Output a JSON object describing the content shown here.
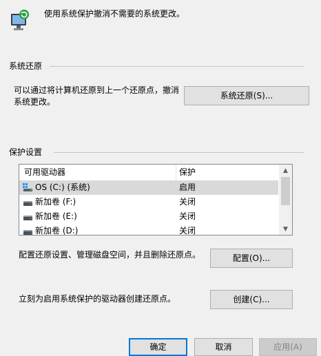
{
  "header": {
    "description": "使用系统保护撤消不需要的系统更改。"
  },
  "restore": {
    "group_label": "系统还原",
    "description_line1": "可以通过将计算机还原到上一个还原点，撤消",
    "description_line2": "系统更改。",
    "button_label": "系统还原(S)..."
  },
  "protection": {
    "group_label": "保护设置",
    "columns": [
      "可用驱动器",
      "保护"
    ],
    "drives": [
      {
        "name": "OS (C:) (系统)",
        "status": "启用",
        "icon": "system-drive-icon"
      },
      {
        "name": "新加卷 (F:)",
        "status": "关闭",
        "icon": "drive-icon"
      },
      {
        "name": "新加卷 (E:)",
        "status": "关闭",
        "icon": "drive-icon"
      },
      {
        "name": "新加卷 (D:)",
        "status": "关闭",
        "icon": "drive-icon"
      }
    ],
    "configure_text": "配置还原设置、管理磁盘空间，并且删除还原点。",
    "configure_button": "配置(O)...",
    "create_text": "立刻为启用系统保护的驱动器创建还原点。",
    "create_button": "创建(C)..."
  },
  "footer": {
    "ok": "确定",
    "cancel": "取消",
    "apply": "应用(A)"
  },
  "colors": {
    "panel_bg": "#f0f0f0",
    "default_button_border": "#0078d7",
    "selected_row": "#d9d9d9"
  }
}
